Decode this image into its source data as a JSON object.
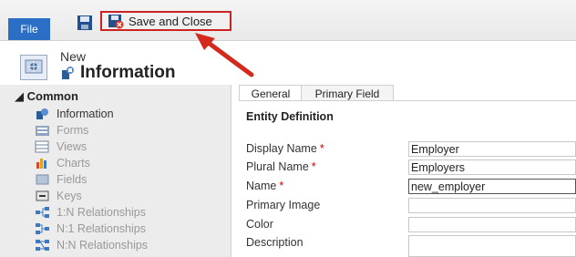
{
  "ribbon": {
    "file_label": "File",
    "save_close_label": "Save and Close"
  },
  "header": {
    "new_label": "New",
    "title": "Information"
  },
  "sidebar": {
    "section_label": "Common",
    "items": [
      {
        "label": "Information",
        "icon": "information-icon"
      },
      {
        "label": "Forms",
        "icon": "forms-icon"
      },
      {
        "label": "Views",
        "icon": "views-icon"
      },
      {
        "label": "Charts",
        "icon": "charts-icon"
      },
      {
        "label": "Fields",
        "icon": "fields-icon"
      },
      {
        "label": "Keys",
        "icon": "keys-icon"
      },
      {
        "label": "1:N Relationships",
        "icon": "relationship-1n-icon"
      },
      {
        "label": "N:1 Relationships",
        "icon": "relationship-n1-icon"
      },
      {
        "label": "N:N Relationships",
        "icon": "relationship-nn-icon"
      }
    ]
  },
  "main": {
    "tabs": [
      {
        "label": "General"
      },
      {
        "label": "Primary Field"
      }
    ],
    "section_title": "Entity Definition",
    "fields": [
      {
        "label": "Display Name",
        "required": "*",
        "value": "Employer"
      },
      {
        "label": "Plural Name",
        "required": "*",
        "value": "Employers"
      },
      {
        "label": "Name",
        "required": "*",
        "value": "new_employer"
      },
      {
        "label": "Primary Image",
        "value": ""
      },
      {
        "label": "Color",
        "value": ""
      },
      {
        "label": "Description",
        "value": ""
      }
    ]
  },
  "colors": {
    "file_tab": "#2a6fc5",
    "highlight": "#cc2222",
    "sidebar_bg": "#ececec"
  }
}
